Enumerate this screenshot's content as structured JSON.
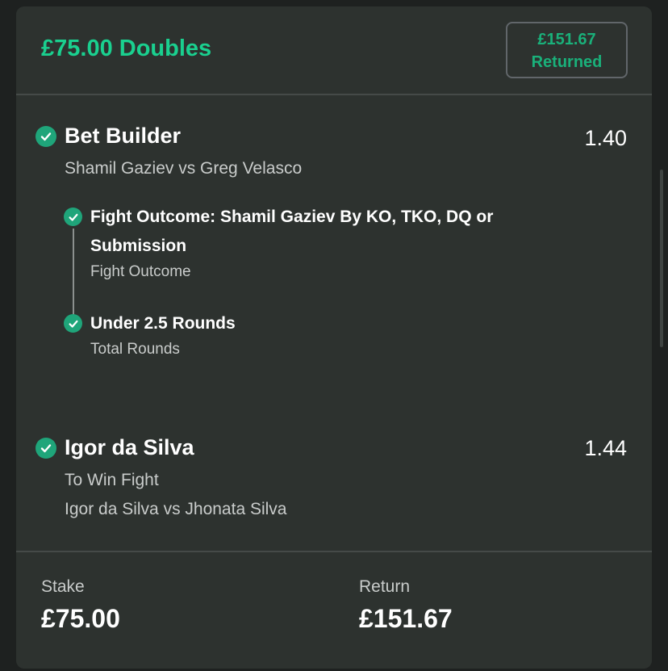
{
  "bet": {
    "title": "£75.00 Doubles",
    "returned_amount": "£151.67",
    "returned_label": "Returned"
  },
  "legs": [
    {
      "title": "Bet Builder",
      "odds": "1.40",
      "event": "Shamil Gaziev vs Greg Velasco",
      "selections": [
        {
          "title_line1": "Fight Outcome: Shamil Gaziev By KO, TKO, DQ or",
          "title_line2": "Submission",
          "market": "Fight Outcome"
        },
        {
          "title_line1": "Under 2.5 Rounds",
          "market": "Total Rounds"
        }
      ]
    },
    {
      "title": "Igor da Silva",
      "odds": "1.44",
      "market": "To Win Fight",
      "event": "Igor da Silva vs Jhonata Silva"
    }
  ],
  "footer": {
    "stake_label": "Stake",
    "stake_value": "£75.00",
    "return_label": "Return",
    "return_value": "£151.67"
  },
  "colors": {
    "accent": "#1ad08f",
    "check": "#1fa57a",
    "card": "#2d322f",
    "background": "#1e2120"
  },
  "icons": [
    "check-circle-icon"
  ]
}
